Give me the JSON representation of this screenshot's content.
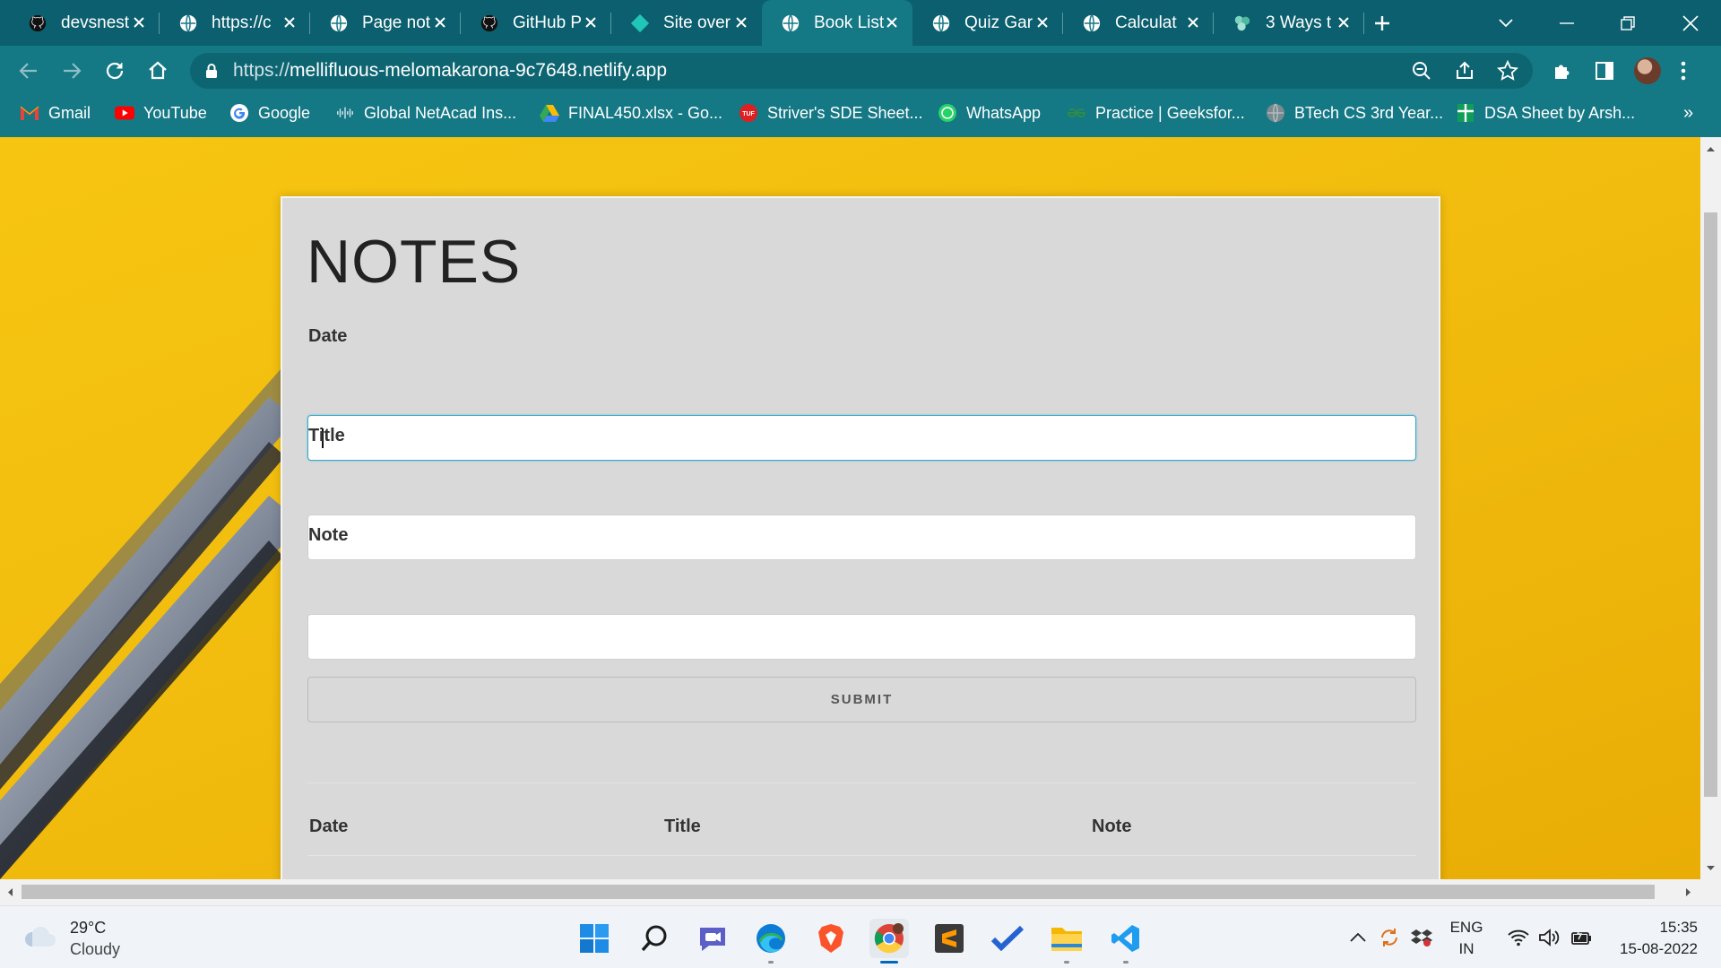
{
  "browser": {
    "tabs": [
      {
        "title": "devsnest",
        "icon": "github-icon",
        "active": false
      },
      {
        "title": "https://c",
        "icon": "globe-icon",
        "active": false
      },
      {
        "title": "Page not",
        "icon": "globe-icon",
        "active": false
      },
      {
        "title": "GitHub P",
        "icon": "github-icon",
        "active": false
      },
      {
        "title": "Site over",
        "icon": "netlify-icon",
        "active": false
      },
      {
        "title": "Book List",
        "icon": "globe-icon",
        "active": true
      },
      {
        "title": "Quiz Gar",
        "icon": "globe-icon",
        "active": false
      },
      {
        "title": "Calculat",
        "icon": "globe-icon",
        "active": false
      },
      {
        "title": "3 Ways t",
        "icon": "chatgpt-icon",
        "active": false
      }
    ],
    "url_scheme": "https://",
    "url_host": "mellifluous-melomakarona-9c7648.netlify.app",
    "bookmarks": [
      {
        "label": "Gmail",
        "icon": "gmail-icon"
      },
      {
        "label": "YouTube",
        "icon": "youtube-icon"
      },
      {
        "label": "Google",
        "icon": "google-icon"
      },
      {
        "label": "Global NetAcad Ins...",
        "icon": "cisco-icon"
      },
      {
        "label": "FINAL450.xlsx - Go...",
        "icon": "drive-icon"
      },
      {
        "label": "Striver's SDE Sheet...",
        "icon": "tuf-icon"
      },
      {
        "label": "WhatsApp",
        "icon": "whatsapp-icon"
      },
      {
        "label": "Practice | Geeksfor...",
        "icon": "gfg-icon"
      },
      {
        "label": "BTech CS 3rd Year...",
        "icon": "globe-icon"
      },
      {
        "label": "DSA Sheet by Arsh...",
        "icon": "sheets-icon"
      }
    ],
    "bookmarks_overflow": "»"
  },
  "page": {
    "heading": "NOTES",
    "form": {
      "date_label": "Date",
      "date_value": "",
      "title_label": "Title",
      "title_value": "",
      "note_label": "Note",
      "note_value": "",
      "submit_label": "SUBMIT"
    },
    "table": {
      "headers": [
        "Date",
        "Title",
        "Note"
      ],
      "rows": []
    }
  },
  "taskbar": {
    "weather_temp": "29°C",
    "weather_desc": "Cloudy",
    "apps": [
      "windows-start-icon",
      "search-icon",
      "teams-chat-icon",
      "edge-icon",
      "brave-icon",
      "chrome-icon",
      "sublime-text-icon",
      "todo-icon",
      "file-explorer-icon",
      "vscode-icon"
    ],
    "language_line1": "ENG",
    "language_line2": "IN",
    "time": "15:35",
    "date": "15-08-2022"
  },
  "colors": {
    "browser_frame": "#0b5f6e",
    "browser_toolbar": "#147885",
    "page_background": "#f6c511",
    "card_background": "#d9d9d9",
    "focus_border": "#33aacc"
  }
}
